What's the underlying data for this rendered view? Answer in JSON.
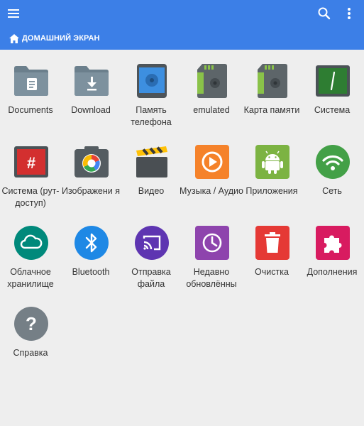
{
  "header": {
    "menu_icon": "hamburger-menu-icon",
    "search_icon": "search-icon",
    "more_icon": "more-vert-icon",
    "breadcrumb": "ДОМАШНИЙ ЭКРАН",
    "accent": "#3c7fe7"
  },
  "items": [
    {
      "label": "Documents"
    },
    {
      "label": "Download"
    },
    {
      "label": "Память телефона"
    },
    {
      "label": "emulated"
    },
    {
      "label": "Карта памяти"
    },
    {
      "label": "Система"
    },
    {
      "label": "Система (рут-доступ)"
    },
    {
      "label": "Изображени я"
    },
    {
      "label": "Видео"
    },
    {
      "label": "Музыка / Аудио"
    },
    {
      "label": "Приложения"
    },
    {
      "label": "Сеть"
    },
    {
      "label": "Облачное хранилище"
    },
    {
      "label": "Bluetooth"
    },
    {
      "label": "Отправка файла"
    },
    {
      "label": "Недавно обновлённы"
    },
    {
      "label": "Очистка"
    },
    {
      "label": "Дополнения"
    },
    {
      "label": "Справка"
    }
  ]
}
